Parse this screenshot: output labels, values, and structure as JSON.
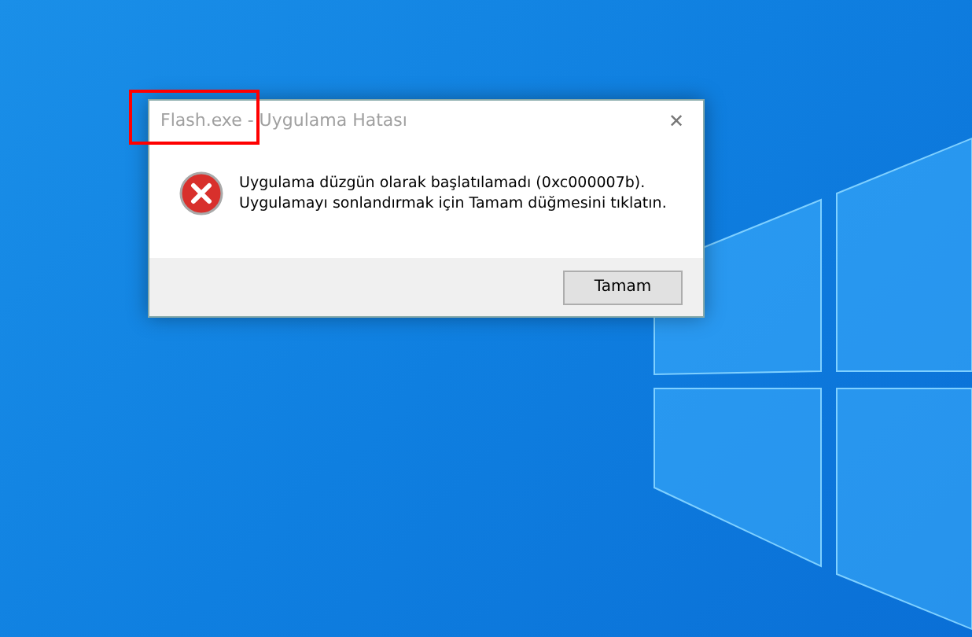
{
  "window": {
    "title": "Flash.exe - Uygulama Hatası",
    "close": "✕"
  },
  "message": [
    "Uygulama düzgün olarak başlatılamadı (0xc000007b).",
    "Uygulamayı sonlandırmak için Tamam düğmesini tıklatın."
  ],
  "buttons": [
    "Tamam"
  ]
}
